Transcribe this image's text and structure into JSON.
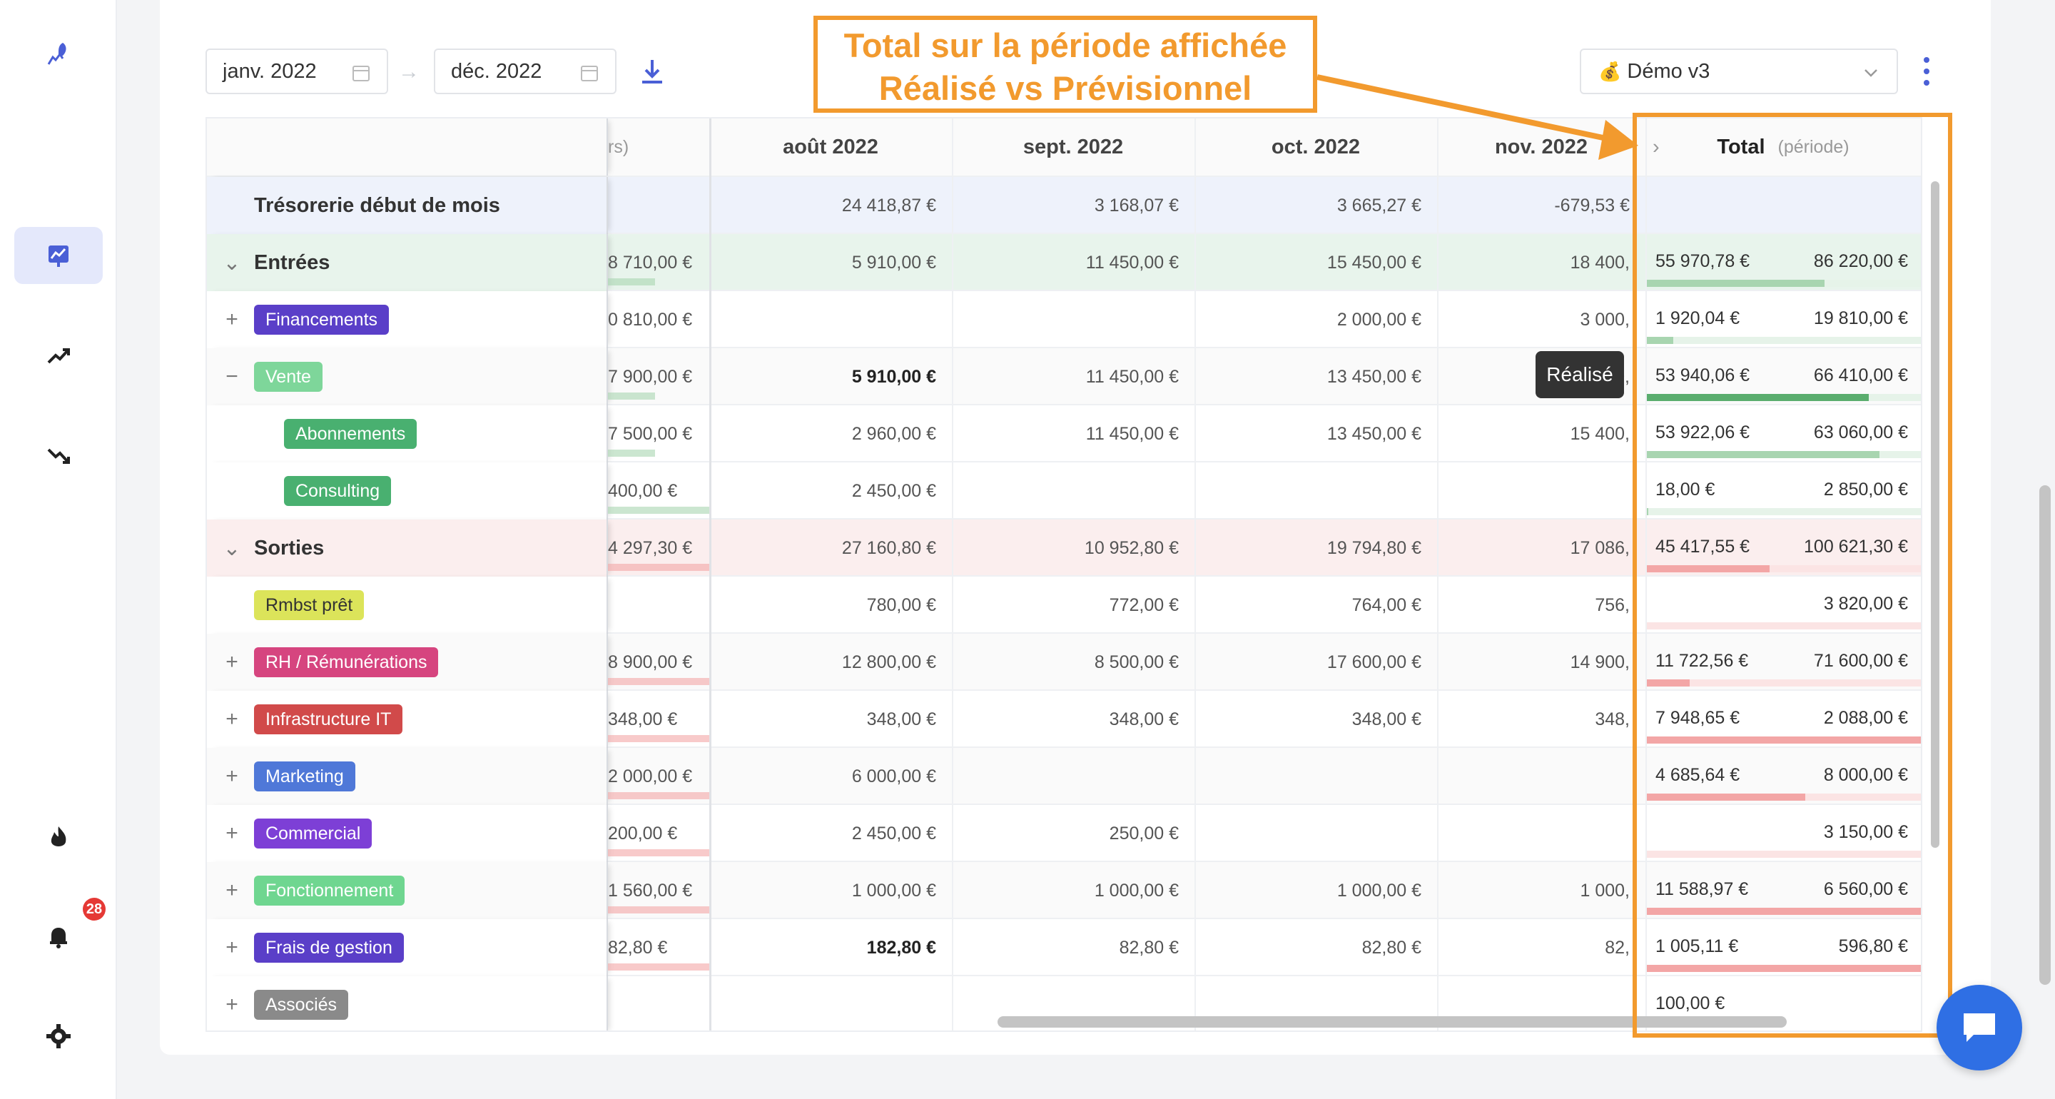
{
  "toolbar": {
    "start_date": "janv. 2022",
    "end_date": "déc. 2022",
    "scenario": "Démo v3",
    "scenario_icon": "money-bag-icon"
  },
  "annotation": {
    "line1": "Total sur la période affichée",
    "line2": "Réalisé vs Prévisionnel"
  },
  "sidebar": {
    "badge_count": "28",
    "items": [
      "logo-rocket-icon",
      "dashboard-chart-icon",
      "trending-up-icon",
      "trending-down-icon",
      "fire-icon",
      "bell-icon",
      "gear-icon"
    ]
  },
  "table": {
    "partial_col_header": "rs)",
    "months": [
      "août 2022",
      "sept. 2022",
      "oct. 2022",
      "nov. 2022"
    ],
    "total_header": "Total",
    "total_sub": "(période)",
    "rows": [
      {
        "label": "Trésorerie début de mois",
        "kind": "treso",
        "partial": "",
        "values": [
          "24 418,87 €",
          "3 168,07 €",
          "3 665,27 €",
          "-679,53 €"
        ],
        "tot_real": "",
        "tot_prev": "",
        "bar_pct": 0
      },
      {
        "label": "Entrées",
        "kind": "group-in",
        "partial": "8 710,00 €",
        "values": [
          "5 910,00 €",
          "11 450,00 €",
          "15 450,00 €",
          "18 400,"
        ],
        "tot_real": "55 970,78 €",
        "tot_prev": "86 220,00 €",
        "bar_pct": 65
      },
      {
        "label": "Financements",
        "kind": "tag",
        "sign": "+",
        "partial": "0 810,00 €",
        "values": [
          "",
          "",
          "2 000,00 €",
          "3 000,"
        ],
        "tot_real": "1 920,04 €",
        "tot_prev": "19 810,00 €",
        "bar_pct": 10
      },
      {
        "label": "Vente",
        "kind": "tag",
        "sign": "−",
        "partial": "7 900,00 €",
        "values": [
          "5 910,00 €",
          "11 450,00 €",
          "13 450,00 €",
          "0,"
        ],
        "tot_real": "53 940,06 €",
        "tot_prev": "66 410,00 €",
        "bar_pct": 81
      },
      {
        "label": "Abonnements",
        "kind": "subtag",
        "partial": "7 500,00 €",
        "values": [
          "2 960,00 €",
          "11 450,00 €",
          "13 450,00 €",
          "15 400,"
        ],
        "tot_real": "53 922,06 €",
        "tot_prev": "63 060,00 €",
        "bar_pct": 85
      },
      {
        "label": "Consulting",
        "kind": "subtag",
        "partial": "400,00 €",
        "values": [
          "2 450,00 €",
          "",
          "",
          ""
        ],
        "tot_real": "18,00 €",
        "tot_prev": "2 850,00 €",
        "bar_pct": 1
      },
      {
        "label": "Sorties",
        "kind": "group-out",
        "partial": "4 297,30 €",
        "values": [
          "27 160,80 €",
          "10 952,80 €",
          "19 794,80 €",
          "17 086,"
        ],
        "tot_real": "45 417,55 €",
        "tot_prev": "100 621,30 €",
        "bar_pct": 45
      },
      {
        "label": "Rmbst prêt",
        "kind": "tag",
        "sign": "",
        "partial": "",
        "values": [
          "780,00 €",
          "772,00 €",
          "764,00 €",
          "756,"
        ],
        "tot_real": "",
        "tot_prev": "3 820,00 €",
        "bar_pct": 0
      },
      {
        "label": "RH / Rémunérations",
        "kind": "tag",
        "sign": "+",
        "partial": "8 900,00 €",
        "values": [
          "12 800,00 €",
          "8 500,00 €",
          "17 600,00 €",
          "14 900,"
        ],
        "tot_real": "11 722,56 €",
        "tot_prev": "71 600,00 €",
        "bar_pct": 16
      },
      {
        "label": "Infrastructure IT",
        "kind": "tag",
        "sign": "+",
        "partial": "348,00 €",
        "values": [
          "348,00 €",
          "348,00 €",
          "348,00 €",
          "348,"
        ],
        "tot_real": "7 948,65 €",
        "tot_prev": "2 088,00 €",
        "bar_pct": 100
      },
      {
        "label": "Marketing",
        "kind": "tag",
        "sign": "+",
        "partial": "2 000,00 €",
        "values": [
          "6 000,00 €",
          "",
          "",
          ""
        ],
        "tot_real": "4 685,64 €",
        "tot_prev": "8 000,00 €",
        "bar_pct": 58
      },
      {
        "label": "Commercial",
        "kind": "tag",
        "sign": "+",
        "partial": "200,00 €",
        "values": [
          "2 450,00 €",
          "250,00 €",
          "",
          ""
        ],
        "tot_real": "",
        "tot_prev": "3 150,00 €",
        "bar_pct": 0
      },
      {
        "label": "Fonctionnement",
        "kind": "tag",
        "sign": "+",
        "partial": "1 560,00 €",
        "values": [
          "1 000,00 €",
          "1 000,00 €",
          "1 000,00 €",
          "1 000,"
        ],
        "tot_real": "11 588,97 €",
        "tot_prev": "6 560,00 €",
        "bar_pct": 100
      },
      {
        "label": "Frais de gestion",
        "kind": "tag",
        "sign": "+",
        "partial": "82,80 €",
        "values": [
          "182,80 €",
          "82,80 €",
          "82,80 €",
          "82,"
        ],
        "tot_real": "1 005,11 €",
        "tot_prev": "596,80 €",
        "bar_pct": 100
      },
      {
        "label": "Associés",
        "kind": "tag",
        "sign": "+",
        "partial": "",
        "values": [
          "",
          "",
          "",
          ""
        ],
        "tot_real": "100,00 €",
        "tot_prev": "",
        "bar_pct": 0
      }
    ]
  },
  "tooltip": "Réalisé",
  "colors": {
    "annotation": "#f29a2e",
    "accent": "#4a5fd6",
    "income_bar": "#a8d5b0",
    "income_bar_strong": "#5aad6e",
    "expense_bar": "#f3a6a6",
    "tags": {
      "Financements": "#5a3fc8",
      "Vente": "#7ed69a",
      "Abonnements": "#49b070",
      "Consulting": "#49b070",
      "Rmbst prêt": "#dce45a",
      "RH / Rémunérations": "#d6457f",
      "Infrastructure IT": "#d14a4a",
      "Marketing": "#4f78d8",
      "Commercial": "#7d3fd6",
      "Fonctionnement": "#6fd690",
      "Frais de gestion": "#5a3fc8",
      "Associés": "#8a8a8a"
    }
  }
}
